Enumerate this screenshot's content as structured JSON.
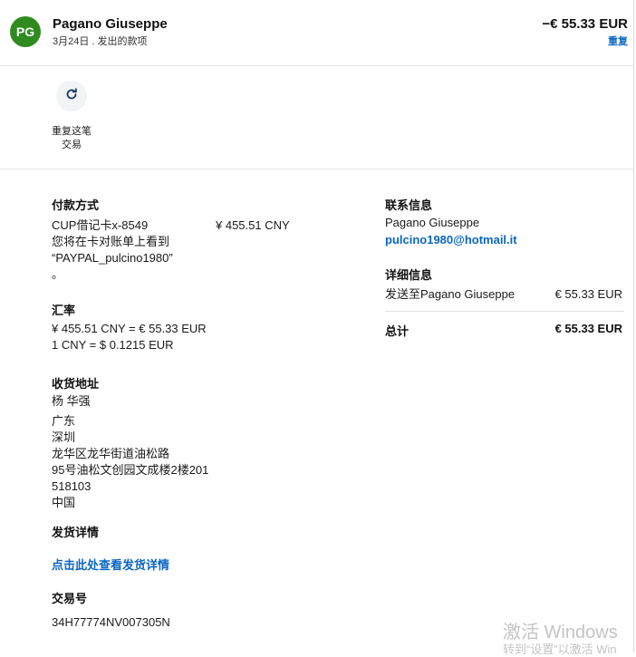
{
  "header": {
    "avatar_initials": "PG",
    "name": "Pagano Giuseppe",
    "subtitle": "3月24日 . 发出的款项",
    "amount": "−€ 55.33 EUR",
    "repeat_link": "重复"
  },
  "repeat_action": {
    "icon": "refresh-icon",
    "label_line1": "重复这笔",
    "label_line2": "交易"
  },
  "payment": {
    "title": "付款方式",
    "method": "CUP借记卡x-8549",
    "amount": "¥ 455.51 CNY",
    "note_line1": "您将在卡对账单上看到",
    "note_line2": "“PAYPAL_pulcino1980”",
    "note_line3": "。"
  },
  "exchange": {
    "title": "汇率",
    "line1": "¥ 455.51 CNY = € 55.33 EUR",
    "line2": "1 CNY = $ 0.1215 EUR"
  },
  "shipping_address": {
    "title": "收货地址",
    "lines": [
      "杨 华强",
      "广东",
      "深圳",
      "龙华区龙华街道油松路",
      "95号油松文创园文成楼2楼201",
      "518103",
      "中国"
    ]
  },
  "shipping_details": {
    "title": "发货详情",
    "link": "点击此处查看发货详情"
  },
  "transaction": {
    "title": "交易号",
    "id": "34H77774NV007305N"
  },
  "contact": {
    "title": "联系信息",
    "name": "Pagano Giuseppe",
    "email": "pulcino1980@hotmail.it"
  },
  "details": {
    "title": "详细信息",
    "sent_to": "发送至Pagano Giuseppe",
    "sent_amount": "€ 55.33 EUR",
    "total_label": "总计",
    "total_amount": "€ 55.33 EUR"
  },
  "watermark": {
    "line1": "激活 Windows",
    "line2": "转到“设置”以激活 Win"
  },
  "colors": {
    "accent": "#0a66c2",
    "avatar": "#2e8b1e"
  }
}
